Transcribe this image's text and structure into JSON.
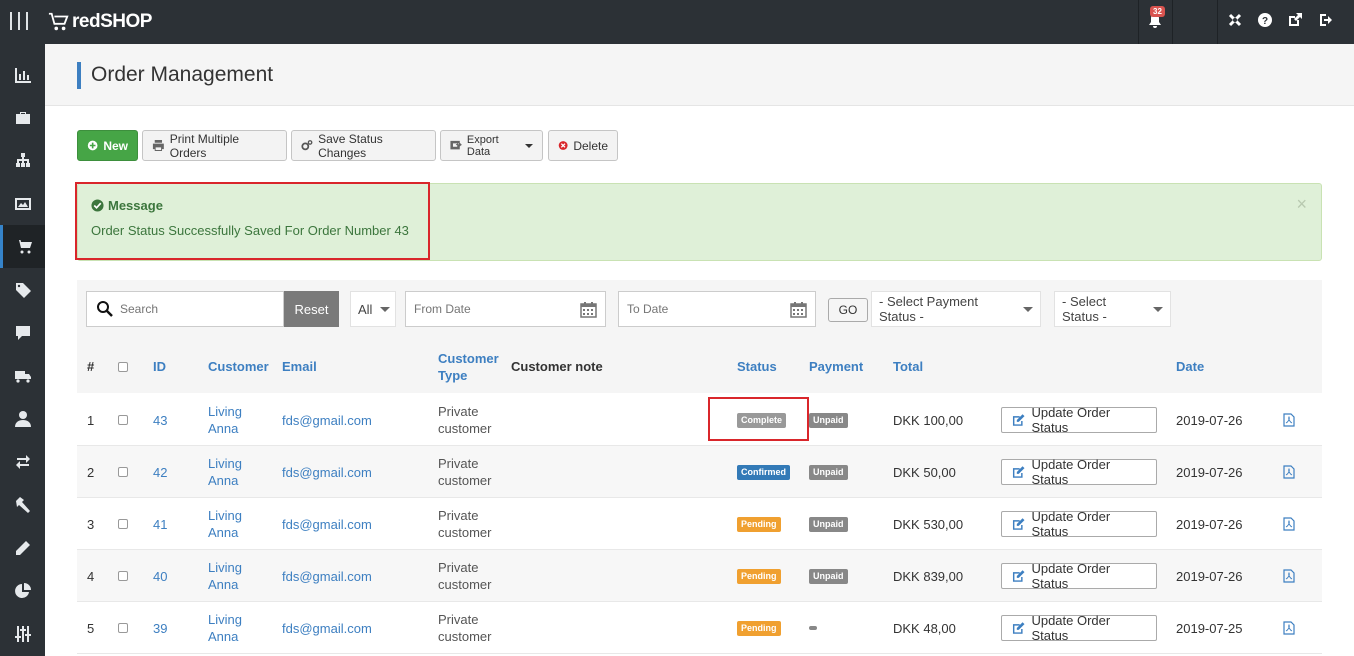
{
  "app": {
    "logo_text": "redSHOP",
    "notification_count": "32"
  },
  "page_title": "Order Management",
  "toolbar": {
    "new_label": "New",
    "print_label": "Print Multiple Orders",
    "save_status_label": "Save Status Changes",
    "export_label": "Export Data",
    "delete_label": "Delete"
  },
  "message": {
    "title": "Message",
    "text": "Order Status Successfully Saved For Order Number 43",
    "close": "×"
  },
  "filters": {
    "search_placeholder": "Search",
    "reset_label": "Reset",
    "all_label": "All",
    "from_date_placeholder": "From Date",
    "to_date_placeholder": "To Date",
    "go_label": "GO",
    "payment_status_label": "- Select Payment Status -",
    "status_label": "- Select Status -"
  },
  "table": {
    "headers": {
      "num": "#",
      "id": "ID",
      "customer": "Customer",
      "email": "Email",
      "customer_type_1": "Customer",
      "customer_type_2": "Type",
      "customer_note": "Customer note",
      "status": "Status",
      "payment": "Payment",
      "total": "Total",
      "date": "Date"
    },
    "update_label": "Update Order Status",
    "rows": [
      {
        "num": "1",
        "id": "43",
        "customer_1": "Living",
        "customer_2": "Anna",
        "email": "fds@gmail.com",
        "type_1": "Private",
        "type_2": "customer",
        "status": "Complete",
        "payment": "Unpaid",
        "total": "DKK 100,00",
        "date": "2019-07-26"
      },
      {
        "num": "2",
        "id": "42",
        "customer_1": "Living",
        "customer_2": "Anna",
        "email": "fds@gmail.com",
        "type_1": "Private",
        "type_2": "customer",
        "status": "Confirmed",
        "payment": "Unpaid",
        "total": "DKK 50,00",
        "date": "2019-07-26"
      },
      {
        "num": "3",
        "id": "41",
        "customer_1": "Living",
        "customer_2": "Anna",
        "email": "fds@gmail.com",
        "type_1": "Private",
        "type_2": "customer",
        "status": "Pending",
        "payment": "Unpaid",
        "total": "DKK 530,00",
        "date": "2019-07-26"
      },
      {
        "num": "4",
        "id": "40",
        "customer_1": "Living",
        "customer_2": "Anna",
        "email": "fds@gmail.com",
        "type_1": "Private",
        "type_2": "customer",
        "status": "Pending",
        "payment": "Unpaid",
        "total": "DKK 839,00",
        "date": "2019-07-26"
      },
      {
        "num": "5",
        "id": "39",
        "customer_1": "Living",
        "customer_2": "Anna",
        "email": "fds@gmail.com",
        "type_1": "Private",
        "type_2": "customer",
        "status": "Pending",
        "payment": "",
        "total": "DKK 48,00",
        "date": "2019-07-25"
      }
    ]
  },
  "colors": {
    "accent": "#3d7fc1",
    "topbar": "#2c3136",
    "success_bg": "#dff0d8",
    "highlight": "#d9262b"
  },
  "sidebar_icons": [
    "stats-icon",
    "briefcase-icon",
    "sitemap-icon",
    "image-icon",
    "cart-icon",
    "tag-icon",
    "comment-icon",
    "truck-icon",
    "user-icon",
    "exchange-icon",
    "hammer-icon",
    "pencil-icon",
    "pie-chart-icon",
    "sliders-icon"
  ]
}
